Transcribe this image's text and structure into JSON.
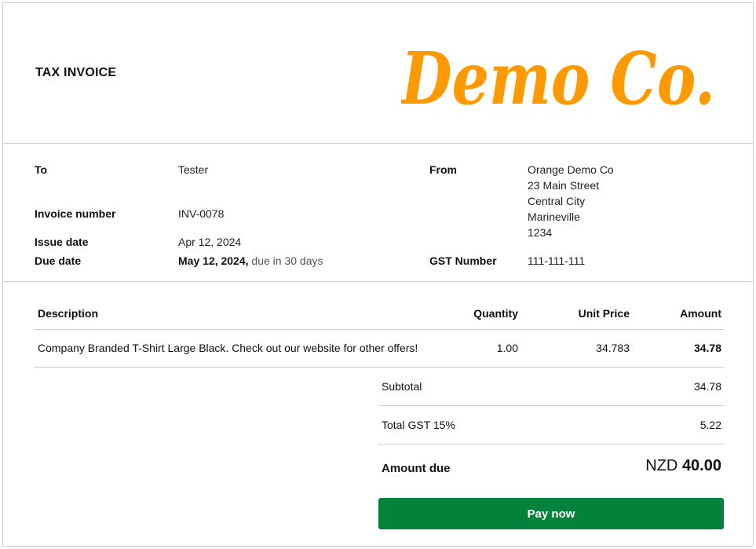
{
  "header": {
    "title": "TAX INVOICE",
    "logo_text": "Demo Co.",
    "logo_color": "#ff9900"
  },
  "details": {
    "to_label": "To",
    "to_value": "Tester",
    "invoice_number_label": "Invoice number",
    "invoice_number_value": "INV-0078",
    "issue_date_label": "Issue date",
    "issue_date_value": "Apr 12, 2024",
    "due_date_label": "Due date",
    "due_date_value": "May 12, 2024,",
    "due_in": "due in 30 days",
    "from_label": "From",
    "from_lines": [
      "Orange Demo Co",
      "23 Main Street",
      "Central City",
      "Marineville",
      "1234"
    ],
    "gst_label": "GST Number",
    "gst_value": "111-111-111"
  },
  "items": {
    "headers": {
      "description": "Description",
      "quantity": "Quantity",
      "unit_price": "Unit Price",
      "amount": "Amount"
    },
    "rows": [
      {
        "description": "Company Branded T-Shirt Large Black. Check out our website for other offers!",
        "quantity": "1.00",
        "unit_price": "34.783",
        "amount": "34.78"
      }
    ]
  },
  "totals": {
    "subtotal_label": "Subtotal",
    "subtotal_value": "34.78",
    "gst_label": "Total GST 15%",
    "gst_value": "5.22",
    "amount_due_label": "Amount due",
    "currency": "NZD",
    "amount_due_value": "40.00"
  },
  "actions": {
    "pay_now_label": "Pay now",
    "pay_now_color": "#03823b"
  }
}
